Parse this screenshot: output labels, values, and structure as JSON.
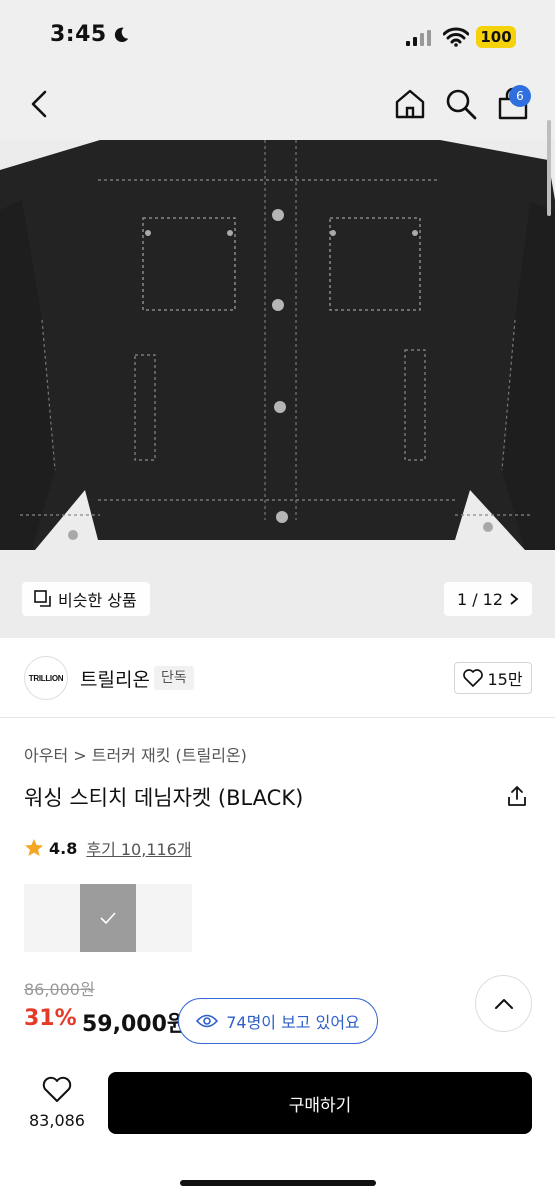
{
  "status_bar": {
    "time": "3:45",
    "battery": "100"
  },
  "nav": {
    "cart_count": "6"
  },
  "gallery": {
    "similar_label": "비슷한 상품",
    "page_indicator": "1 / 12"
  },
  "brand": {
    "logo_text": "TRILLION",
    "name": "트릴리온",
    "badge": "단독",
    "likes": "15만"
  },
  "product": {
    "breadcrumb": "아우터 > 트러커 재킷 (트릴리온)",
    "title": "워싱 스티치 데님자켓 (BLACK)",
    "rating": "4.8",
    "reviews": "후기 10,116개",
    "original_price": "86,000원",
    "discount_rate": "31%",
    "sale_price": "59,000원"
  },
  "viewers": {
    "label": "74명이 보고 있어요"
  },
  "bottom": {
    "wish_count": "83,086",
    "buy_label": "구매하기"
  },
  "colors": {
    "accent_blue": "#2f6fe0",
    "discount_red": "#e63a28",
    "star": "#f5a623",
    "buy_button": "#000000"
  },
  "icons": [
    "moon-icon",
    "signal-icon",
    "wifi-icon",
    "back-icon",
    "home-icon",
    "search-icon",
    "cart-icon",
    "similar-icon",
    "chevron-right-icon",
    "heart-icon",
    "share-icon",
    "star-icon",
    "check-icon",
    "eye-icon",
    "chevron-up-icon"
  ]
}
